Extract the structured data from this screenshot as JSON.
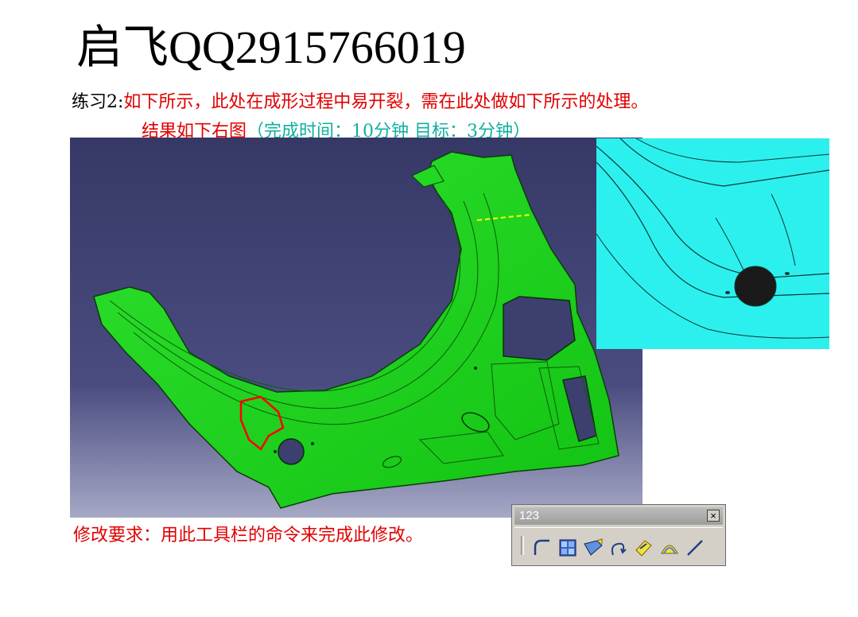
{
  "header": {
    "title": "启飞QQ2915766019"
  },
  "exercise": {
    "label": "练习2:",
    "instruction": "如下所示，此处在成形过程中易开裂，需在此处做如下所示的处理。",
    "result_prefix": "结果如下右图",
    "result_time": "（完成时间：10分钟   目标：3分钟）"
  },
  "requirement": {
    "text": "修改要求：用此工具栏的命令来完成此修改。"
  },
  "toolbar": {
    "name": "123",
    "close_label": "×",
    "tools": [
      "fillet-icon",
      "split-faces-icon",
      "sweep-icon",
      "curve-icon",
      "surface-edit-icon",
      "shape-fillet-icon",
      "line-icon"
    ]
  },
  "colors": {
    "background": "#3d3f6e",
    "part": "#1ed21e",
    "detail_part": "#2cf0ee",
    "highlight": "#ff0000",
    "instruction_text": "#e00000",
    "time_text": "#10b0a0"
  }
}
